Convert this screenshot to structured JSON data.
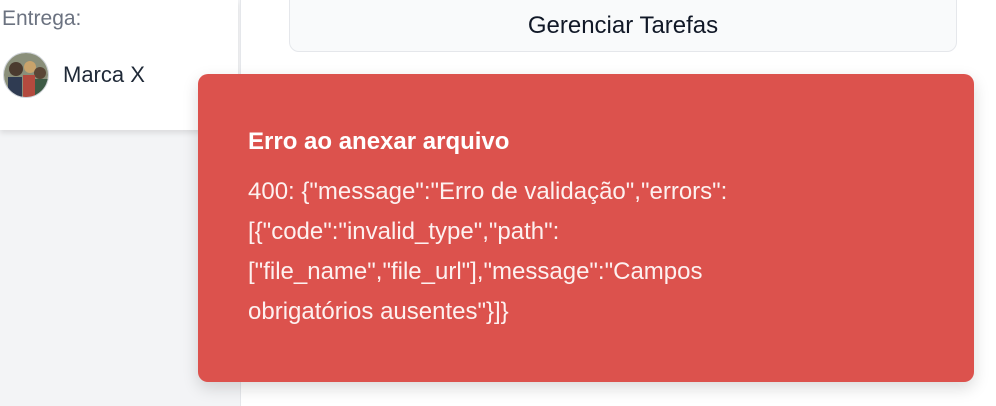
{
  "delivery": {
    "label": "Entrega:",
    "brand_name": "Marca X",
    "avatar_icon": "brand-avatar-icon"
  },
  "main": {
    "manage_tasks_label": "Gerenciar Tarefas"
  },
  "toast": {
    "title": "Erro ao anexar arquivo",
    "message": "400: {\"message\":\"Erro de validação\",\"errors\":\n[{\"code\":\"invalid_type\",\"path\":\n[\"file_name\",\"file_url\"],\"message\":\"Campos\nobrigatórios ausentes\"}]}",
    "background_color": "#dc524d"
  }
}
